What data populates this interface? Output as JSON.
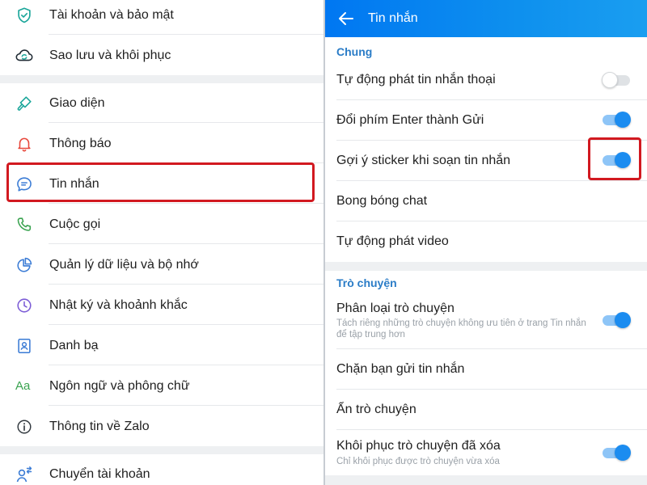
{
  "left": {
    "items": [
      {
        "label": "Tài khoản và bảo mật",
        "icon": "shield-icon"
      },
      {
        "label": "Sao lưu và khôi phục",
        "icon": "cloud-sync-icon"
      },
      {
        "label": "Giao diện",
        "icon": "paint-brush-icon"
      },
      {
        "label": "Thông báo",
        "icon": "bell-icon"
      },
      {
        "label": "Tin nhắn",
        "icon": "chat-bubble-icon"
      },
      {
        "label": "Cuộc gọi",
        "icon": "phone-icon"
      },
      {
        "label": "Quản lý dữ liệu và bộ nhớ",
        "icon": "pie-chart-icon"
      },
      {
        "label": "Nhật ký và khoảnh khắc",
        "icon": "clock-icon"
      },
      {
        "label": "Danh bạ",
        "icon": "contact-book-icon"
      },
      {
        "label": "Ngôn ngữ và phông chữ",
        "icon": "font-aa-icon"
      },
      {
        "label": "Thông tin về Zalo",
        "icon": "info-icon"
      },
      {
        "label": "Chuyển tài khoản",
        "icon": "switch-account-icon"
      }
    ],
    "icon_text_aa": "Aa",
    "highlighted_item": "Tin nhắn"
  },
  "right": {
    "header": {
      "title": "Tin nhắn",
      "back_icon": "arrow-left-icon"
    },
    "section_general": "Chung",
    "general": [
      {
        "label": "Tự động phát tin nhắn thoại",
        "toggle": "off"
      },
      {
        "label": "Đổi phím Enter thành Gửi",
        "toggle": "on"
      },
      {
        "label": "Gợi ý sticker khi soạn tin nhắn",
        "toggle": "on"
      },
      {
        "label": "Bong bóng chat"
      },
      {
        "label": "Tự động phát video"
      }
    ],
    "section_chat": "Trò chuyện",
    "chat": [
      {
        "label": "Phân loại trò chuyện",
        "sub": "Tách riêng những trò chuyện không ưu tiên ở trang Tin nhắn để tập trung hơn",
        "toggle": "on"
      },
      {
        "label": "Chặn bạn gửi tin nhắn"
      },
      {
        "label": "Ẩn trò chuyện"
      },
      {
        "label": "Khôi phục trò chuyện đã xóa",
        "sub": "Chỉ khôi phục được trò chuyện vừa xóa",
        "toggle": "on"
      }
    ]
  },
  "colors": {
    "accent": "#0077f2",
    "icon_teal": "#1aa69a",
    "icon_blue": "#3a7bd5",
    "icon_red": "#e8483c",
    "icon_green": "#3aa350",
    "icon_purple": "#7c5cd6",
    "highlight_red": "#d21920",
    "toggle_on": "#1b8cf0"
  }
}
